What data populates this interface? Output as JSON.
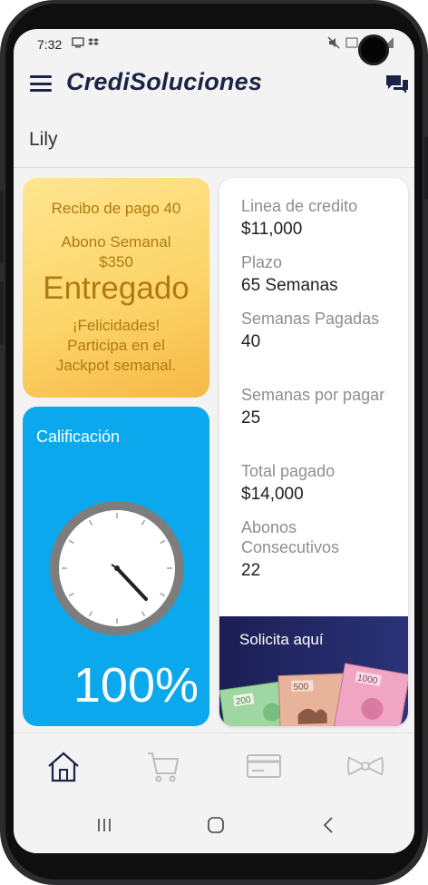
{
  "status_bar": {
    "time": "7:32"
  },
  "app": {
    "title": "CrediSoluciones"
  },
  "user": {
    "name": "Lily"
  },
  "payment_card": {
    "receipt": "Recibo de pago 40",
    "payment_label": "Abono Semanal",
    "payment_amount": "$350",
    "status": "Entregado",
    "message_1": "¡Felicidades!",
    "message_2": "Participa en el",
    "message_3": "Jackpot semanal."
  },
  "rating_card": {
    "title": "Calificación",
    "value": "100%"
  },
  "stats": [
    {
      "label": "Linea de credito",
      "value": "$11,000"
    },
    {
      "label": "Plazo",
      "value": "65 Semanas"
    },
    {
      "label": "Semanas Pagadas",
      "value": "40"
    },
    {
      "label": "Semanas por pagar",
      "value": "25"
    },
    {
      "label": "Total pagado",
      "value": "$14,000"
    },
    {
      "label": "Abonos Consecutivos",
      "value": "22"
    }
  ],
  "request_banner": {
    "label": "Solicita aquí",
    "bill_200": "200",
    "bill_500": "500",
    "bill_1000": "1000"
  },
  "bottom_nav": [
    "home-icon",
    "cart-icon",
    "card-icon",
    "bowtie-icon"
  ],
  "colors": {
    "brand": "#1b2447",
    "yellow_card": "#fcd56a",
    "blue_card": "#0ba8ee",
    "banner": "#1c1e54"
  }
}
